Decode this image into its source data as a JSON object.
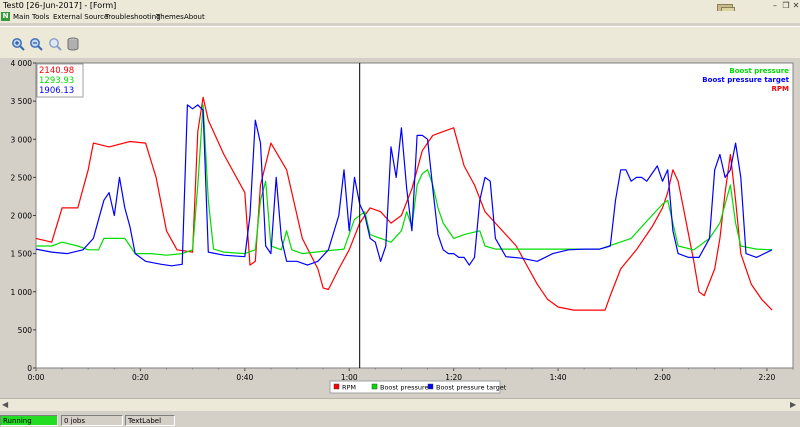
{
  "window": {
    "title": "Test0 [26-Jun-2017] - [Form]"
  },
  "menu": [
    "Main",
    "Tools",
    "External Source",
    "Troubleshooting",
    "Themes",
    "About"
  ],
  "toolbar": {
    "icons": [
      "zoom-in-icon",
      "zoom-out-icon",
      "zoom-reset-icon",
      "database-icon"
    ]
  },
  "readout": {
    "rpm": "2140.98",
    "boost": "1293.93",
    "target": "1906.13"
  },
  "status": {
    "state": "Running",
    "jobs": "0 jobs",
    "label": "TextLabel"
  },
  "colors": {
    "rpm": "#ff0000",
    "boost": "#00dd00",
    "target": "#0000ff",
    "cursor": "#000000"
  },
  "chart_data": {
    "type": "line",
    "title": "",
    "xlabel": "",
    "ylabel": "",
    "xlim": [
      "0:00",
      "2:20"
    ],
    "ylim": [
      0,
      4000
    ],
    "x_ticks": [
      "0:00",
      "0:20",
      "0:40",
      "1:00",
      "1:20",
      "1:40",
      "2:00",
      "2:20"
    ],
    "y_ticks": [
      "0",
      "500",
      "1 000",
      "1 500",
      "2 000",
      "2 500",
      "3 000",
      "3 500",
      "4 000"
    ],
    "legend_position": "top-right",
    "bottom_legend": [
      "RPM",
      "Boost pressure",
      "Boost pressure target"
    ],
    "top_legend": [
      "Boost pressure",
      "Boost pressure target",
      "RPM"
    ],
    "cursor_x": "1:02",
    "series": [
      {
        "name": "RPM",
        "color": "#ff0000",
        "points": [
          [
            0,
            1700
          ],
          [
            3,
            1650
          ],
          [
            5,
            2100
          ],
          [
            8,
            2100
          ],
          [
            10,
            2600
          ],
          [
            11,
            2950
          ],
          [
            14,
            2900
          ],
          [
            18,
            2970
          ],
          [
            21,
            2950
          ],
          [
            23,
            2500
          ],
          [
            25,
            1800
          ],
          [
            27,
            1550
          ],
          [
            30,
            1520
          ],
          [
            31,
            3100
          ],
          [
            32,
            3550
          ],
          [
            33,
            3250
          ],
          [
            36,
            2800
          ],
          [
            40,
            2300
          ],
          [
            41,
            1350
          ],
          [
            42,
            1400
          ],
          [
            43,
            2400
          ],
          [
            45,
            2950
          ],
          [
            48,
            2600
          ],
          [
            51,
            1700
          ],
          [
            54,
            1300
          ],
          [
            55,
            1050
          ],
          [
            56,
            1030
          ],
          [
            58,
            1300
          ],
          [
            60,
            1550
          ],
          [
            62,
            1900
          ],
          [
            64,
            2100
          ],
          [
            66,
            2050
          ],
          [
            68,
            1900
          ],
          [
            70,
            2000
          ],
          [
            72,
            2350
          ],
          [
            74,
            2850
          ],
          [
            76,
            3050
          ],
          [
            78,
            3100
          ],
          [
            80,
            3150
          ],
          [
            82,
            2650
          ],
          [
            84,
            2400
          ],
          [
            86,
            2050
          ],
          [
            88,
            1900
          ],
          [
            92,
            1600
          ],
          [
            94,
            1350
          ],
          [
            96,
            1100
          ],
          [
            98,
            900
          ],
          [
            100,
            800
          ],
          [
            103,
            760
          ],
          [
            106,
            760
          ],
          [
            109,
            760
          ],
          [
            110,
            950
          ],
          [
            112,
            1300
          ],
          [
            115,
            1550
          ],
          [
            118,
            1850
          ],
          [
            120,
            2100
          ],
          [
            121,
            2300
          ],
          [
            122,
            2600
          ],
          [
            123,
            2450
          ],
          [
            124,
            2100
          ],
          [
            125,
            1750
          ],
          [
            126,
            1400
          ],
          [
            127,
            1000
          ],
          [
            128,
            950
          ],
          [
            130,
            1300
          ],
          [
            131,
            1700
          ],
          [
            132,
            2300
          ],
          [
            133,
            2800
          ],
          [
            134,
            2200
          ],
          [
            135,
            1500
          ],
          [
            137,
            1100
          ],
          [
            139,
            900
          ],
          [
            141,
            760
          ]
        ]
      },
      {
        "name": "Boost pressure",
        "color": "#00dd00",
        "points": [
          [
            0,
            1600
          ],
          [
            3,
            1600
          ],
          [
            5,
            1650
          ],
          [
            8,
            1600
          ],
          [
            10,
            1550
          ],
          [
            12,
            1550
          ],
          [
            13,
            1700
          ],
          [
            15,
            1700
          ],
          [
            17,
            1700
          ],
          [
            19,
            1500
          ],
          [
            22,
            1500
          ],
          [
            25,
            1480
          ],
          [
            28,
            1500
          ],
          [
            30,
            1550
          ],
          [
            31,
            2400
          ],
          [
            32,
            3450
          ],
          [
            33,
            2200
          ],
          [
            34,
            1560
          ],
          [
            36,
            1520
          ],
          [
            40,
            1500
          ],
          [
            42,
            1550
          ],
          [
            43,
            2200
          ],
          [
            44,
            2450
          ],
          [
            45,
            1600
          ],
          [
            47,
            1550
          ],
          [
            48,
            1800
          ],
          [
            49,
            1550
          ],
          [
            51,
            1500
          ],
          [
            56,
            1540
          ],
          [
            59,
            1560
          ],
          [
            61,
            1950
          ],
          [
            63,
            2050
          ],
          [
            64,
            1750
          ],
          [
            66,
            1700
          ],
          [
            68,
            1650
          ],
          [
            70,
            1800
          ],
          [
            71,
            2050
          ],
          [
            72,
            1850
          ],
          [
            73,
            2400
          ],
          [
            74,
            2550
          ],
          [
            75,
            2600
          ],
          [
            76,
            2400
          ],
          [
            77,
            2100
          ],
          [
            78,
            1900
          ],
          [
            80,
            1700
          ],
          [
            82,
            1750
          ],
          [
            85,
            1800
          ],
          [
            86,
            1600
          ],
          [
            88,
            1560
          ],
          [
            92,
            1560
          ],
          [
            100,
            1560
          ],
          [
            108,
            1560
          ],
          [
            114,
            1700
          ],
          [
            116,
            1850
          ],
          [
            118,
            2000
          ],
          [
            120,
            2150
          ],
          [
            121,
            2200
          ],
          [
            122,
            1900
          ],
          [
            123,
            1600
          ],
          [
            126,
            1550
          ],
          [
            129,
            1700
          ],
          [
            131,
            1900
          ],
          [
            133,
            2400
          ],
          [
            134,
            1900
          ],
          [
            135,
            1600
          ],
          [
            138,
            1560
          ],
          [
            141,
            1550
          ]
        ]
      },
      {
        "name": "Boost pressure target",
        "color": "#0000ff",
        "points": [
          [
            0,
            1560
          ],
          [
            3,
            1520
          ],
          [
            6,
            1500
          ],
          [
            9,
            1550
          ],
          [
            11,
            1700
          ],
          [
            12,
            1950
          ],
          [
            13,
            2200
          ],
          [
            14,
            2300
          ],
          [
            15,
            2000
          ],
          [
            16,
            2500
          ],
          [
            17,
            2100
          ],
          [
            18,
            1850
          ],
          [
            19,
            1500
          ],
          [
            21,
            1400
          ],
          [
            24,
            1360
          ],
          [
            26,
            1340
          ],
          [
            28,
            1360
          ],
          [
            29,
            3450
          ],
          [
            30,
            3400
          ],
          [
            31,
            3450
          ],
          [
            32,
            3380
          ],
          [
            33,
            1520
          ],
          [
            36,
            1480
          ],
          [
            40,
            1460
          ],
          [
            41,
            2000
          ],
          [
            42,
            3250
          ],
          [
            43,
            2950
          ],
          [
            44,
            1600
          ],
          [
            45,
            1500
          ],
          [
            46,
            2500
          ],
          [
            47,
            1700
          ],
          [
            48,
            1400
          ],
          [
            50,
            1400
          ],
          [
            52,
            1350
          ],
          [
            54,
            1400
          ],
          [
            56,
            1550
          ],
          [
            58,
            2000
          ],
          [
            59,
            2600
          ],
          [
            60,
            1800
          ],
          [
            61,
            2500
          ],
          [
            62,
            2150
          ],
          [
            63,
            2000
          ],
          [
            64,
            1700
          ],
          [
            65,
            1650
          ],
          [
            66,
            1400
          ],
          [
            67,
            1600
          ],
          [
            68,
            2900
          ],
          [
            69,
            2500
          ],
          [
            70,
            3150
          ],
          [
            71,
            2350
          ],
          [
            72,
            1800
          ],
          [
            73,
            3050
          ],
          [
            74,
            3050
          ],
          [
            75,
            3000
          ],
          [
            76,
            2350
          ],
          [
            77,
            1750
          ],
          [
            78,
            1550
          ],
          [
            79,
            1500
          ],
          [
            80,
            1500
          ],
          [
            81,
            1450
          ],
          [
            82,
            1450
          ],
          [
            83,
            1350
          ],
          [
            84,
            1450
          ],
          [
            85,
            2200
          ],
          [
            86,
            2500
          ],
          [
            87,
            2450
          ],
          [
            88,
            1700
          ],
          [
            90,
            1460
          ],
          [
            93,
            1440
          ],
          [
            96,
            1400
          ],
          [
            99,
            1500
          ],
          [
            102,
            1550
          ],
          [
            105,
            1560
          ],
          [
            108,
            1560
          ],
          [
            110,
            1600
          ],
          [
            111,
            2200
          ],
          [
            112,
            2600
          ],
          [
            113,
            2600
          ],
          [
            114,
            2450
          ],
          [
            115,
            2500
          ],
          [
            116,
            2500
          ],
          [
            117,
            2450
          ],
          [
            118,
            2550
          ],
          [
            119,
            2650
          ],
          [
            120,
            2450
          ],
          [
            121,
            2600
          ],
          [
            122,
            1800
          ],
          [
            123,
            1500
          ],
          [
            125,
            1450
          ],
          [
            127,
            1450
          ],
          [
            129,
            1700
          ],
          [
            130,
            2600
          ],
          [
            131,
            2800
          ],
          [
            132,
            2500
          ],
          [
            133,
            2600
          ],
          [
            134,
            2950
          ],
          [
            135,
            2500
          ],
          [
            136,
            1500
          ],
          [
            138,
            1450
          ],
          [
            141,
            1550
          ]
        ]
      }
    ]
  }
}
